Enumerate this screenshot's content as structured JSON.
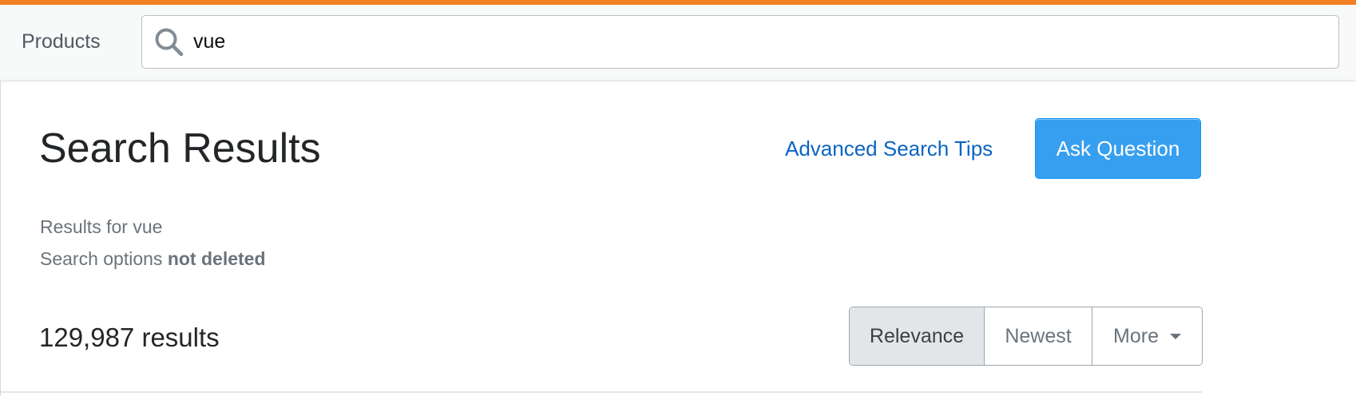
{
  "header": {
    "products_label": "Products",
    "search": {
      "value": "vue",
      "icon": "search-icon"
    },
    "accent_color": "#f48024"
  },
  "main": {
    "title": "Search Results",
    "advanced_search_tips": "Advanced Search Tips",
    "ask_question": "Ask Question",
    "results_for_prefix": "Results for",
    "results_for_query": "vue",
    "search_options_prefix": "Search options",
    "search_options_value": "not deleted",
    "results_count": "129,987 results",
    "sort": {
      "options": [
        "Relevance",
        "Newest",
        "More"
      ],
      "selected": "Relevance"
    }
  },
  "colors": {
    "primary_button": "#379fef",
    "link": "#0a64c2"
  }
}
